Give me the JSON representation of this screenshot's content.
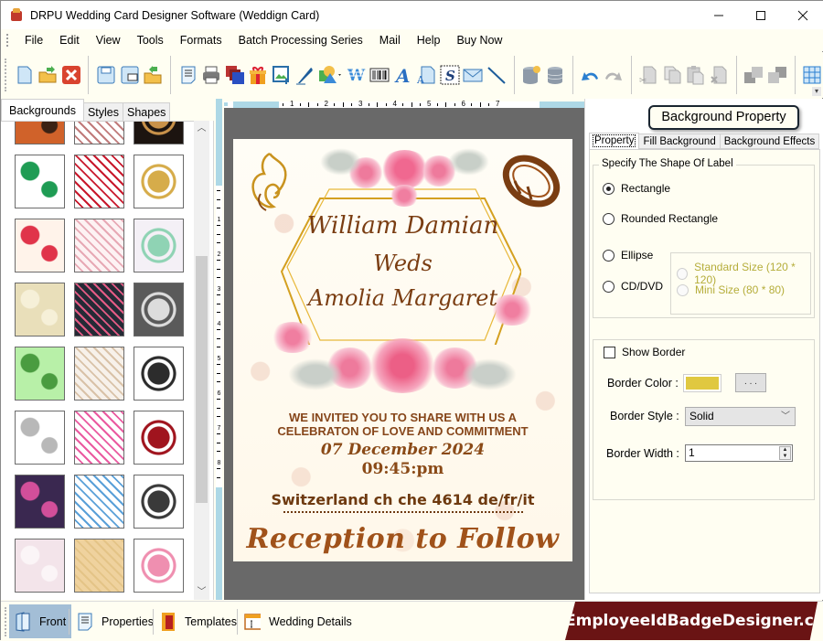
{
  "window": {
    "title": "DRPU Wedding Card Designer Software (Weddign Card)",
    "controls": {
      "minimize": "—",
      "maximize": "☐",
      "close": "✕"
    }
  },
  "menu": [
    "File",
    "Edit",
    "View",
    "Tools",
    "Formats",
    "Batch Processing Series",
    "Mail",
    "Help",
    "Buy Now"
  ],
  "toolbar": {
    "groups": [
      [
        "new-icon",
        "open-icon",
        "close-file-icon"
      ],
      [
        "save-icon",
        "save-as-icon",
        "export-icon"
      ],
      [
        "properties-icon",
        "print-icon",
        "layers-icon",
        "gift-icon",
        "insert-image-icon",
        "signature-pen-icon",
        "shapes-dropdown-icon",
        "wordart-icon",
        "barcode-icon",
        "text-icon",
        "text-box-icon",
        "symbol-icon",
        "mail-icon",
        "line-icon"
      ],
      [
        "database-add-icon",
        "database-icon"
      ],
      [
        "undo-icon",
        "redo-icon"
      ],
      [
        "cut-icon",
        "copy-icon",
        "paste-icon",
        "delete-icon"
      ],
      [
        "bring-forward-icon",
        "send-backward-icon"
      ],
      [
        "grid-icon"
      ]
    ]
  },
  "left_panel": {
    "tabs": [
      "Backgrounds",
      "Styles",
      "Shapes"
    ],
    "active_tab": "Backgrounds",
    "thumbnails": [
      {
        "name": "bg-orange-calligraphy",
        "colors": [
          "#d0622a",
          "#3b2214"
        ]
      },
      {
        "name": "bg-elephant",
        "colors": [
          "#ffffff",
          "#c07a7a"
        ]
      },
      {
        "name": "bg-black-floral",
        "colors": [
          "#1c1410",
          "#c9924a"
        ]
      },
      {
        "name": "bg-leaf-ganesha",
        "colors": [
          "#ffffff",
          "#1f9c54"
        ]
      },
      {
        "name": "bg-rose-petals",
        "colors": [
          "#ffffff",
          "#c8182c"
        ]
      },
      {
        "name": "bg-crescent-star",
        "colors": [
          "#ffffff",
          "#d6ac4a"
        ]
      },
      {
        "name": "bg-hearts",
        "colors": [
          "#fff3ea",
          "#e0344a"
        ]
      },
      {
        "name": "bg-pink-lace",
        "colors": [
          "#fdf2f3",
          "#e7a9b5"
        ]
      },
      {
        "name": "bg-mandala",
        "colors": [
          "#f4f0f6",
          "#8fd3b4"
        ]
      },
      {
        "name": "bg-cream-rose",
        "colors": [
          "#e9dfba",
          "#f6f0d8"
        ]
      },
      {
        "name": "bg-navy-floral",
        "colors": [
          "#252a36",
          "#e55b85"
        ]
      },
      {
        "name": "bg-grey-lace",
        "colors": [
          "#5a5a5a",
          "#dcdcdc"
        ]
      },
      {
        "name": "bg-green-ornament",
        "colors": [
          "#b8f0a8",
          "#4a9c40"
        ]
      },
      {
        "name": "bg-beige-floral",
        "colors": [
          "#f7f1ea",
          "#d9c2a8"
        ]
      },
      {
        "name": "bg-bw-pattern",
        "colors": [
          "#ffffff",
          "#2c2c2c"
        ]
      },
      {
        "name": "bg-swans",
        "colors": [
          "#ffffff",
          "#b8b8b8"
        ]
      },
      {
        "name": "bg-pink-butterflies",
        "colors": [
          "#ffffff",
          "#ea5aa0"
        ]
      },
      {
        "name": "bg-ik-onkar",
        "colors": [
          "#ffffff",
          "#a0141e"
        ]
      },
      {
        "name": "bg-paisley",
        "colors": [
          "#3a2850",
          "#d24f9a"
        ]
      },
      {
        "name": "bg-colorful-flowers",
        "colors": [
          "#ffffff",
          "#5aa0d8"
        ]
      },
      {
        "name": "bg-sketch-couple",
        "colors": [
          "#ffffff",
          "#3a3a3a"
        ]
      },
      {
        "name": "bg-pink-marble",
        "colors": [
          "#f3e4ea",
          "#fbf5f7"
        ]
      },
      {
        "name": "bg-sand",
        "colors": [
          "#efd29e",
          "#e4c487"
        ]
      },
      {
        "name": "bg-sakura",
        "colors": [
          "#ffffff",
          "#ef8fb0"
        ]
      }
    ]
  },
  "rulers": {
    "horizontal": [
      "1",
      "2",
      "3",
      "4",
      "5",
      "6",
      "7"
    ],
    "vertical": [
      "1",
      "2",
      "3",
      "4",
      "5",
      "6",
      "7",
      "8"
    ]
  },
  "card": {
    "groom": "William Damian",
    "weds": "Weds",
    "bride": "Amolia Margaret",
    "invite_line1": "WE INVITED YOU TO SHARE WITH US A",
    "invite_line2": "CELEBRATON OF LOVE AND COMMITMENT",
    "date": "07 December 2024",
    "time": "09:45:pm",
    "place": "Switzerland ch che 4614 de/fr/it",
    "reception": "Reception to Follow"
  },
  "right_panel": {
    "title": "Background Property",
    "tabs": [
      "Property",
      "Fill Background",
      "Background Effects"
    ],
    "active_tab": "Property",
    "shape_group": {
      "legend": "Specify The Shape Of Label",
      "options": [
        {
          "label": "Rectangle",
          "checked": true
        },
        {
          "label": "Rounded Rectangle",
          "checked": false
        },
        {
          "label": "Ellipse",
          "checked": false
        },
        {
          "label": "CD/DVD",
          "checked": false
        }
      ],
      "cd_sizes": [
        {
          "label": "Standard Size (120 * 120)",
          "checked": false,
          "enabled": false
        },
        {
          "label": "Mini Size (80 * 80)",
          "checked": false,
          "enabled": false
        }
      ]
    },
    "border": {
      "show_border_label": "Show Border",
      "show_border": false,
      "color_label": "Border Color :",
      "color_value": "#e0c840",
      "color_button": ". . .",
      "style_label": "Border Style :",
      "style_value": "Solid",
      "width_label": "Border Width :",
      "width_value": "1"
    }
  },
  "bottom_bar": {
    "buttons": [
      {
        "label": "Front",
        "active": true
      },
      {
        "label": "Properties",
        "active": false
      },
      {
        "label": "Templates",
        "active": false
      },
      {
        "label": "Wedding Details",
        "active": false
      }
    ],
    "brand": "EmployeeIdBadgeDesigner.com"
  }
}
